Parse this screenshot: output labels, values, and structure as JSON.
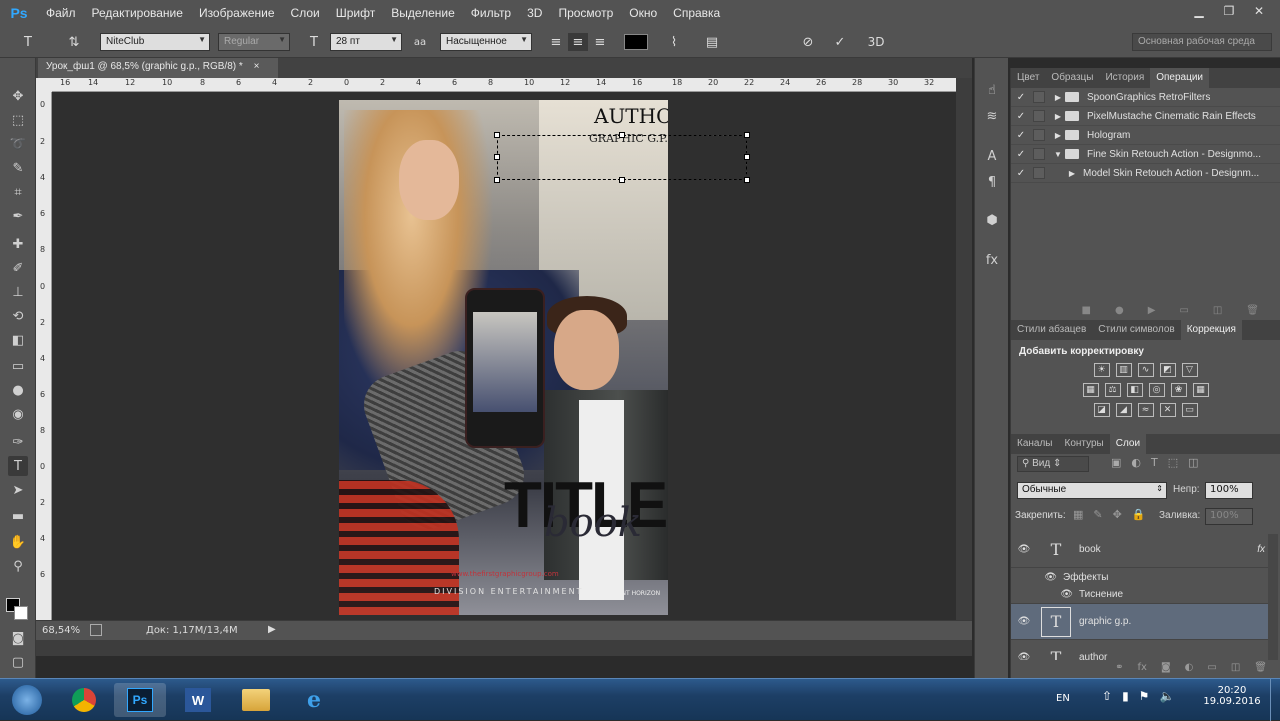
{
  "app": {
    "logo": "Ps"
  },
  "menu": [
    "Файл",
    "Редактирование",
    "Изображение",
    "Слои",
    "Шрифт",
    "Выделение",
    "Фильтр",
    "3D",
    "Просмотр",
    "Окно",
    "Справка"
  ],
  "window_controls": {
    "minimize": "▁",
    "restore": "❐",
    "close": "✕"
  },
  "options": {
    "font_family": "NiteClub",
    "font_style": "Regular",
    "font_size": "28 пт",
    "aa_label": "aa",
    "antialias": "Насыщенное",
    "workspace": "Основная рабочая среда",
    "threed": "3D"
  },
  "document": {
    "tab_title": "Урок_фш1 @ 68,5% (graphic g.p., RGB/8) *",
    "close": "×",
    "zoom": "68,54%",
    "doc_size": "Док: 1,17М/13,4М"
  },
  "ruler": {
    "h_labels": [
      "16",
      "14",
      "12",
      "10",
      "8",
      "6",
      "4",
      "2",
      "0",
      "2",
      "4",
      "6",
      "8",
      "10",
      "12",
      "14",
      "16",
      "18",
      "20",
      "22",
      "24",
      "26",
      "28",
      "30",
      "32"
    ],
    "v_labels": [
      "0",
      "2",
      "4",
      "6",
      "8",
      "0",
      "2",
      "4",
      "6",
      "8",
      "0",
      "2",
      "4",
      "6"
    ]
  },
  "poster": {
    "author": "AUTHOR",
    "graphic": "GRAPHIC G.P.",
    "title": "TITLE",
    "book": "book",
    "url": "www.thefirstgraphicgroup.com",
    "credits": "DIVISION  ENTERTAINMENT",
    "studio": "DISTANT HORIZON"
  },
  "panels": {
    "actions_tabs": [
      "Цвет",
      "Образцы",
      "История",
      "Операции"
    ],
    "actions": [
      {
        "label": "SpoonGraphics RetroFilters",
        "expanded": false,
        "indent": 0
      },
      {
        "label": "PixelMustache Cinematic Rain Effects",
        "expanded": false,
        "indent": 0
      },
      {
        "label": "Hologram",
        "expanded": false,
        "indent": 0
      },
      {
        "label": "Fine Skin Retouch Action - Designmo...",
        "expanded": true,
        "indent": 0
      },
      {
        "label": "Model Skin Retouch Action - Designm...",
        "expanded": false,
        "indent": 1
      }
    ],
    "adjust_tabs": [
      "Стили абзацев",
      "Стили символов",
      "Коррекция"
    ],
    "adjust_title": "Добавить корректировку",
    "layers_tabs": [
      "Каналы",
      "Контуры",
      "Слои"
    ],
    "layer_filter": "Вид",
    "blend_mode": "Обычные",
    "opacity_label": "Непр:",
    "opacity": "100%",
    "lock_label": "Закрепить:",
    "fill_label": "Заливка:",
    "fill": "100%",
    "layers": [
      {
        "name": "book",
        "type": "text",
        "fx": "fx",
        "selected": false
      },
      {
        "name": "Эффекты",
        "type": "effects",
        "selected": false
      },
      {
        "name": "Тиснение",
        "type": "effect",
        "selected": false
      },
      {
        "name": "graphic g.p.",
        "type": "text",
        "selected": true
      },
      {
        "name": "author",
        "type": "text",
        "selected": false
      }
    ]
  },
  "taskbar": {
    "lang": "EN",
    "time": "20:20",
    "date": "19.09.2016",
    "apps": [
      "start",
      "chrome",
      "photoshop",
      "word",
      "explorer",
      "ie"
    ]
  }
}
